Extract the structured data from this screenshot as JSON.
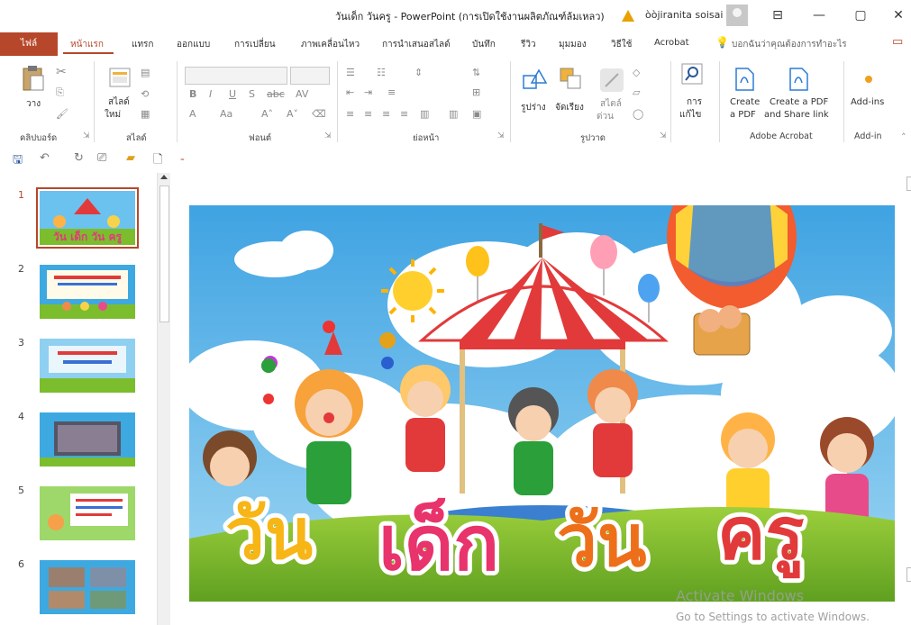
{
  "window": {
    "title": "วันเด็ก วันครู  -  PowerPoint (การเปิดใช้งานผลิตภัณฑ์ล้มเหลว)",
    "user": "òòjiranita soisai",
    "min_glyph": "—",
    "restore_glyph": "▢",
    "close_glyph": "✕",
    "display_glyph": "⊟"
  },
  "tabs": {
    "file": "ไฟล์",
    "items": [
      "หน้าแรก",
      "แทรก",
      "ออกแบบ",
      "การเปลี่ยน",
      "ภาพเคลื่อนไหว",
      "การนำเสนอสไลด์",
      "บันทึก",
      "รีวิว",
      "มุมมอง",
      "วิธีใช้",
      "Acrobat"
    ],
    "tell_me": "บอกฉันว่าคุณต้องการทำอะไร"
  },
  "ribbon": {
    "clipboard": {
      "paste": "วาง",
      "label": "คลิปบอร์ด"
    },
    "slides": {
      "new_slide_1": "สไลด์",
      "new_slide_2": "ใหม่",
      "label": "สไลด์"
    },
    "font": {
      "label": "ฟอนต์",
      "font_name": "",
      "font_size": ""
    },
    "paragraph": {
      "label": "ย่อหน้า"
    },
    "drawing": {
      "shapes": "รูปร่าง",
      "arrange": "จัดเรียง",
      "styles_1": "สไตล์",
      "styles_2": "ด่วน",
      "label": "รูปวาด"
    },
    "editing": {
      "find_1": "การ",
      "find_2": "แก้ไข"
    },
    "acrobat": {
      "create_pdf_1": "Create",
      "create_pdf_2": "a PDF",
      "share_1": "Create a PDF",
      "share_2": "and Share link",
      "label": "Adobe Acrobat"
    },
    "addins": {
      "button": "Add-ins",
      "label": "Add-in"
    }
  },
  "thumbnails": [
    {
      "num": "1",
      "selected": true
    },
    {
      "num": "2",
      "selected": false
    },
    {
      "num": "3",
      "selected": false
    },
    {
      "num": "4",
      "selected": false
    },
    {
      "num": "5",
      "selected": false
    },
    {
      "num": "6",
      "selected": false
    }
  ],
  "slide": {
    "title_text": "วัน เด็ก วัน ครู"
  },
  "watermark": {
    "line1": "Activate Windows",
    "line2": "Go to Settings to activate Windows."
  },
  "colors": {
    "accent": "#b7472a",
    "sky": "#5fb6e6",
    "grass": "#7cbd2e"
  }
}
